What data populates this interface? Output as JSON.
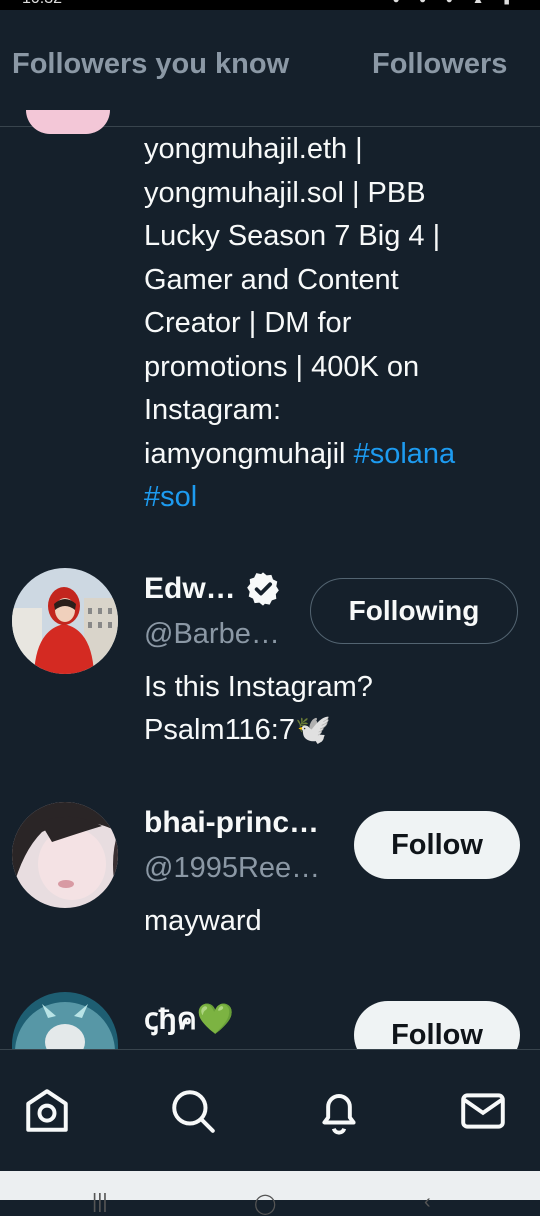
{
  "status_bar": {
    "time": "10:32"
  },
  "tabs": [
    {
      "label": "Followers you know"
    },
    {
      "label": "Followers"
    }
  ],
  "users": [
    {
      "bio_lines": [
        "yongmuhajil.eth |",
        "yongmuhajil.sol | PBB",
        "Lucky Season 7 Big 4 |",
        "Gamer and Content",
        "Creator | DM for",
        "promotions | 400K on",
        "Instagram:",
        "iamyongmuhajil"
      ],
      "hashtag_1": "#solana",
      "hashtag_2": "#sol"
    },
    {
      "name": "Edw…",
      "handle": "@Barbe…",
      "button": "Following",
      "bio_line_1": "Is this Instagram?",
      "bio_line_2": "Psalm116:7🕊️"
    },
    {
      "name": "bhai-princ…",
      "handle": "@1995Ree…",
      "button": "Follow",
      "bio": "mayward"
    },
    {
      "name": "ꞔђค💚",
      "button": "Follow"
    }
  ],
  "nav": [
    {
      "icon": "home-icon"
    },
    {
      "icon": "search-icon"
    },
    {
      "icon": "bell-icon"
    },
    {
      "icon": "mail-icon"
    }
  ]
}
